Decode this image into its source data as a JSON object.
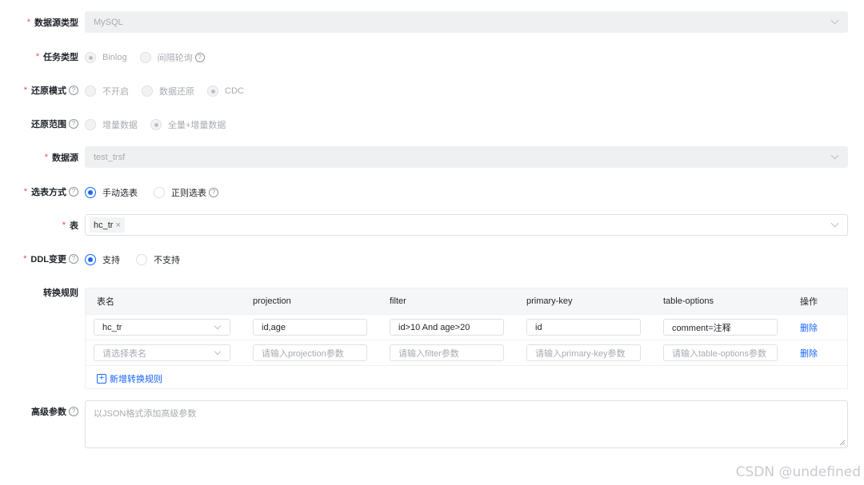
{
  "form": {
    "datasource_type": {
      "label": "数据源类型",
      "required": true,
      "value": "MySQL"
    },
    "task_type": {
      "label": "任务类型",
      "required": true,
      "options": [
        "Binlog",
        "间隔轮询"
      ],
      "selected": "Binlog"
    },
    "restore_mode": {
      "label": "还原模式",
      "required": true,
      "options": [
        "不开启",
        "数据还原",
        "CDC"
      ],
      "selected": "CDC"
    },
    "restore_range": {
      "label": "还原范围",
      "required": false,
      "options": [
        "增量数据",
        "全量+增量数据"
      ],
      "selected": "全量+增量数据"
    },
    "datasource": {
      "label": "数据源",
      "required": true,
      "value": "test_trsf"
    },
    "table_select_mode": {
      "label": "选表方式",
      "required": true,
      "options": [
        "手动选表",
        "正则选表"
      ],
      "selected": "手动选表"
    },
    "table": {
      "label": "表",
      "required": true,
      "tags": [
        "hc_tr"
      ]
    },
    "ddl_change": {
      "label": "DDL变更",
      "required": true,
      "options": [
        "支持",
        "不支持"
      ],
      "selected": "支持"
    },
    "transform_rules": {
      "label": "转换规则",
      "columns": [
        "表名",
        "projection",
        "filter",
        "primary-key",
        "table-options",
        "操作"
      ],
      "rows": [
        {
          "table": "hc_tr",
          "projection": "id,age",
          "filter": "id>10 And age>20",
          "primary_key": "id",
          "table_options": "comment=注释",
          "action": "删除"
        }
      ],
      "placeholders": {
        "table": "请选择表名",
        "projection": "请输入projection参数",
        "filter": "请输入filter参数",
        "primary_key": "请输入primary-key参数",
        "table_options": "请输入table-options参数",
        "action": "删除"
      },
      "add_label": "新增转换规则"
    },
    "advanced_params": {
      "label": "高级参数",
      "placeholder": "以JSON格式添加高级参数"
    }
  },
  "watermark": "CSDN @undefined",
  "colors": {
    "primary": "#1664ff",
    "required": "#f54a45",
    "disabled_bg": "#eff0f1"
  }
}
